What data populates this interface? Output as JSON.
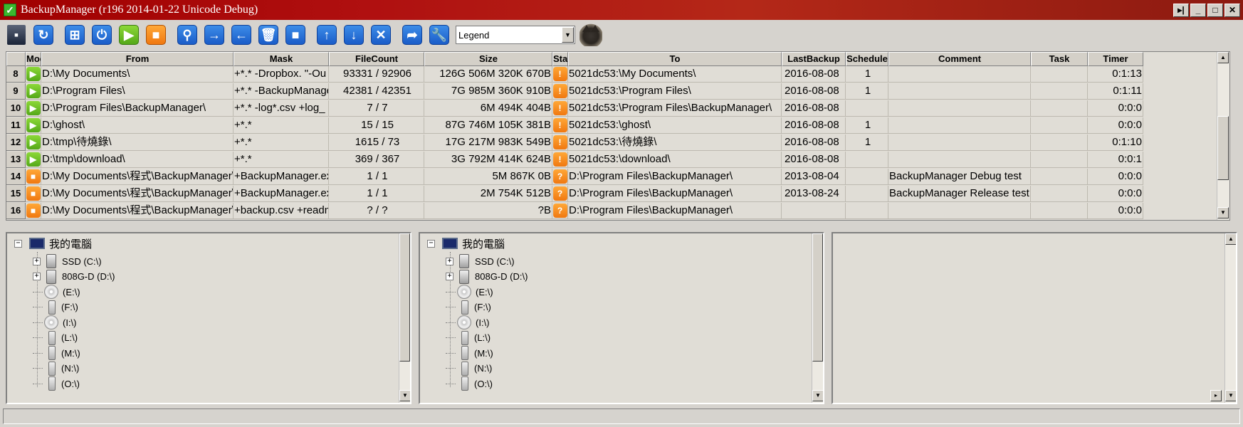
{
  "window": {
    "title": "BackupManager (r196 2014-01-22 Unicode Debug)",
    "buttons": [
      "▸|",
      "_",
      "□",
      "✕"
    ]
  },
  "toolbar": {
    "icons": [
      "save-icon",
      "refresh-icon",
      "windows-icon",
      "power-icon",
      "play-icon",
      "stop-icon",
      "search-icon",
      "arrow-right-icon",
      "arrow-left-icon",
      "trash-icon",
      "stop-small-icon",
      "arrow-up-icon",
      "arrow-down-icon",
      "delete-icon",
      "share-icon",
      "wrench-icon"
    ],
    "legend_value": "Legend"
  },
  "grid": {
    "columns": [
      "Mod",
      "From",
      "Mask",
      "FileCount",
      "Size",
      "Statu",
      "To",
      "LastBackup",
      "Schedule",
      "Comment",
      "Task",
      "Timer"
    ],
    "rows": [
      {
        "no": "8",
        "mode": "play",
        "from": "D:\\My Documents\\",
        "mask": "+*.* -Dropbox. \"-Ou",
        "filecount": "93331 / 92906",
        "size": "126G 506M 320K 670B",
        "status": "!",
        "to": "5021dc53:\\My Documents\\",
        "last": "2016-08-08",
        "schedule": "1",
        "comment": "",
        "task": "",
        "timer": "0:1:13"
      },
      {
        "no": "9",
        "mode": "play",
        "from": "D:\\Program Files\\",
        "mask": "+*.* -BackupManage",
        "filecount": "42381 / 42351",
        "size": "7G 985M 360K 910B",
        "status": "!",
        "to": "5021dc53:\\Program Files\\",
        "last": "2016-08-08",
        "schedule": "1",
        "comment": "",
        "task": "",
        "timer": "0:1:11"
      },
      {
        "no": "10",
        "mode": "play",
        "from": "D:\\Program Files\\BackupManager\\",
        "mask": "+*.* -log*.csv +log_",
        "filecount": "7 / 7",
        "size": "6M 494K 404B",
        "status": "!",
        "to": "5021dc53:\\Program Files\\BackupManager\\",
        "last": "2016-08-08",
        "schedule": "",
        "comment": "",
        "task": "",
        "timer": "0:0:0"
      },
      {
        "no": "11",
        "mode": "play",
        "from": "D:\\ghost\\",
        "mask": "+*.*",
        "filecount": "15 / 15",
        "size": "87G 746M 105K 381B",
        "status": "!",
        "to": "5021dc53:\\ghost\\",
        "last": "2016-08-08",
        "schedule": "1",
        "comment": "",
        "task": "",
        "timer": "0:0:0"
      },
      {
        "no": "12",
        "mode": "play",
        "from": "D:\\tmp\\待燒錄\\",
        "mask": "+*.*",
        "filecount": "1615 / 73",
        "size": "17G 217M 983K 549B",
        "status": "!",
        "to": "5021dc53:\\待燒錄\\",
        "last": "2016-08-08",
        "schedule": "1",
        "comment": "",
        "task": "",
        "timer": "0:1:10"
      },
      {
        "no": "13",
        "mode": "play",
        "from": "D:\\tmp\\download\\",
        "mask": "+*.*",
        "filecount": "369 / 367",
        "size": "3G 792M 414K 624B",
        "status": "!",
        "to": "5021dc53:\\download\\",
        "last": "2016-08-08",
        "schedule": "",
        "comment": "",
        "task": "",
        "timer": "0:0:1"
      },
      {
        "no": "14",
        "mode": "stop",
        "from": "D:\\My Documents\\程式\\BackupManager\\tr",
        "mask": "+BackupManager.exe",
        "filecount": "1 / 1",
        "size": "5M 867K 0B",
        "status": "?",
        "to": "D:\\Program Files\\BackupManager\\",
        "last": "2013-08-04",
        "schedule": "",
        "comment": "BackupManager Debug test",
        "task": "",
        "timer": "0:0:0"
      },
      {
        "no": "15",
        "mode": "stop",
        "from": "D:\\My Documents\\程式\\BackupManager\\tr",
        "mask": "+BackupManager.exe",
        "filecount": "1 / 1",
        "size": "2M 754K 512B",
        "status": "?",
        "to": "D:\\Program Files\\BackupManager\\",
        "last": "2013-08-24",
        "schedule": "",
        "comment": "BackupManager Release test",
        "task": "",
        "timer": "0:0:0"
      },
      {
        "no": "16",
        "mode": "stop",
        "from": "D:\\My Documents\\程式\\BackupManager\\tr",
        "mask": "+backup.csv +readm",
        "filecount": "? / ?",
        "size": "?B",
        "status": "?",
        "to": "D:\\Program Files\\BackupManager\\",
        "last": "",
        "schedule": "",
        "comment": "",
        "task": "",
        "timer": "0:0:0"
      }
    ]
  },
  "tree": {
    "root": "我的電腦",
    "drives": [
      {
        "label": "SSD (C:\\)",
        "type": "hd",
        "expandable": true
      },
      {
        "label": "808G-D (D:\\)",
        "type": "hd",
        "expandable": true
      },
      {
        "label": "(E:\\)",
        "type": "cd",
        "expandable": false
      },
      {
        "label": "(F:\\)",
        "type": "usb",
        "expandable": false
      },
      {
        "label": "(I:\\)",
        "type": "cd",
        "expandable": false
      },
      {
        "label": "(L:\\)",
        "type": "usb",
        "expandable": false
      },
      {
        "label": "(M:\\)",
        "type": "usb",
        "expandable": false
      },
      {
        "label": "(N:\\)",
        "type": "usb",
        "expandable": false
      },
      {
        "label": "(O:\\)",
        "type": "usb",
        "expandable": false
      }
    ]
  },
  "colors": {
    "title_bg": "#a00000",
    "accent_blue": "#1a5cc8",
    "accent_green": "#54a818",
    "accent_orange": "#f07810"
  }
}
